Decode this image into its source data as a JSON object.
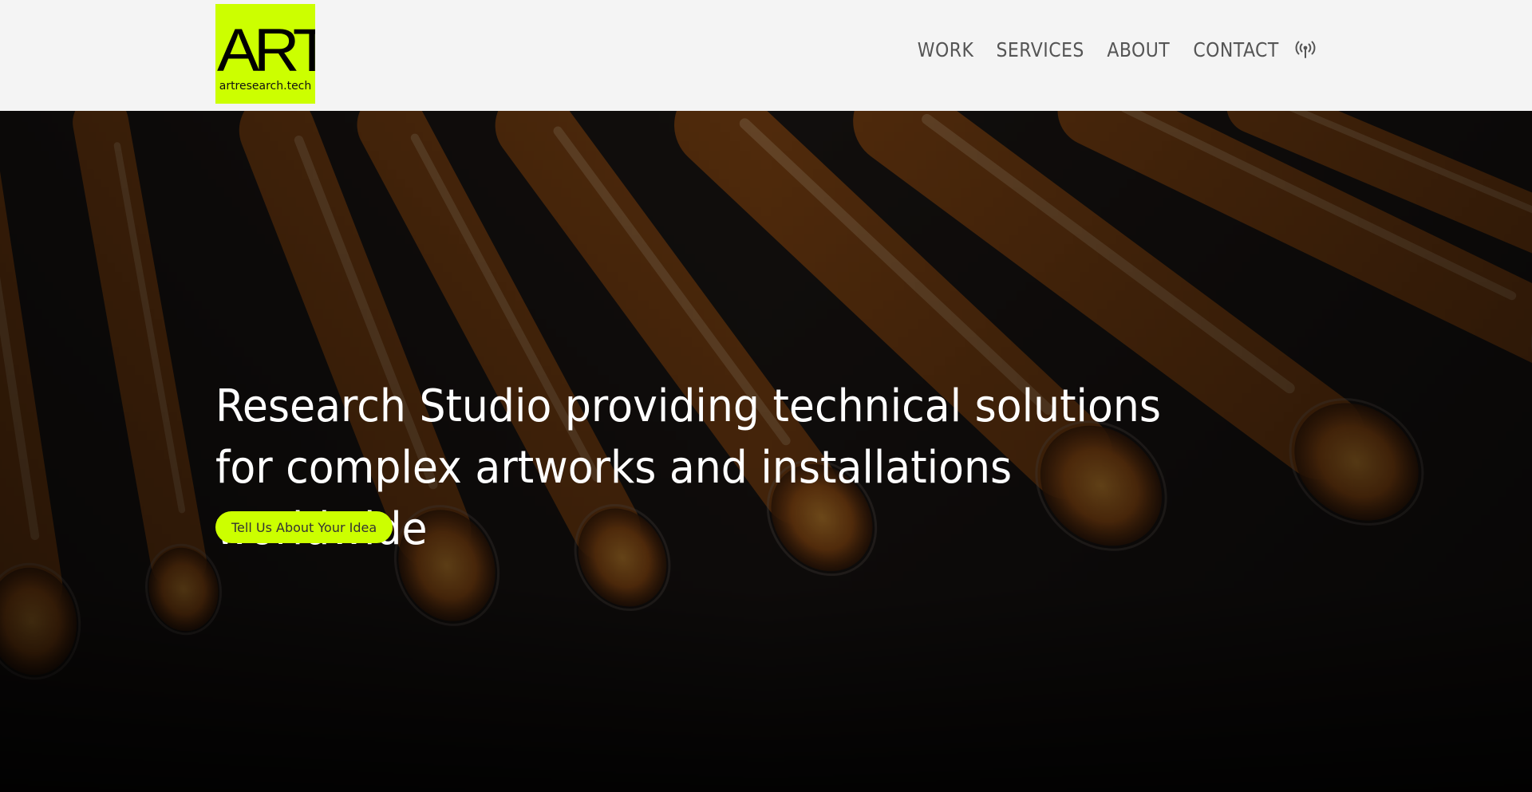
{
  "header": {
    "logo": {
      "mark": "ART",
      "domain": "artresearch.tech",
      "color": "#ccff00"
    },
    "nav": [
      {
        "label": "WORK"
      },
      {
        "label": "SERVICES"
      },
      {
        "label": "ABOUT"
      },
      {
        "label": "CONTACT"
      }
    ],
    "nav_icon": "broadcast-icon"
  },
  "hero": {
    "title": "Research Studio providing technical solutions for complex artworks and installations worldwide",
    "cta_label": "Tell Us About Your Idea",
    "background": "glowing-orange-glass-tubes"
  },
  "colors": {
    "accent": "#ccff00",
    "header_bg": "#f4f4f4",
    "nav_text": "#555555",
    "hero_text": "#ffffff"
  }
}
